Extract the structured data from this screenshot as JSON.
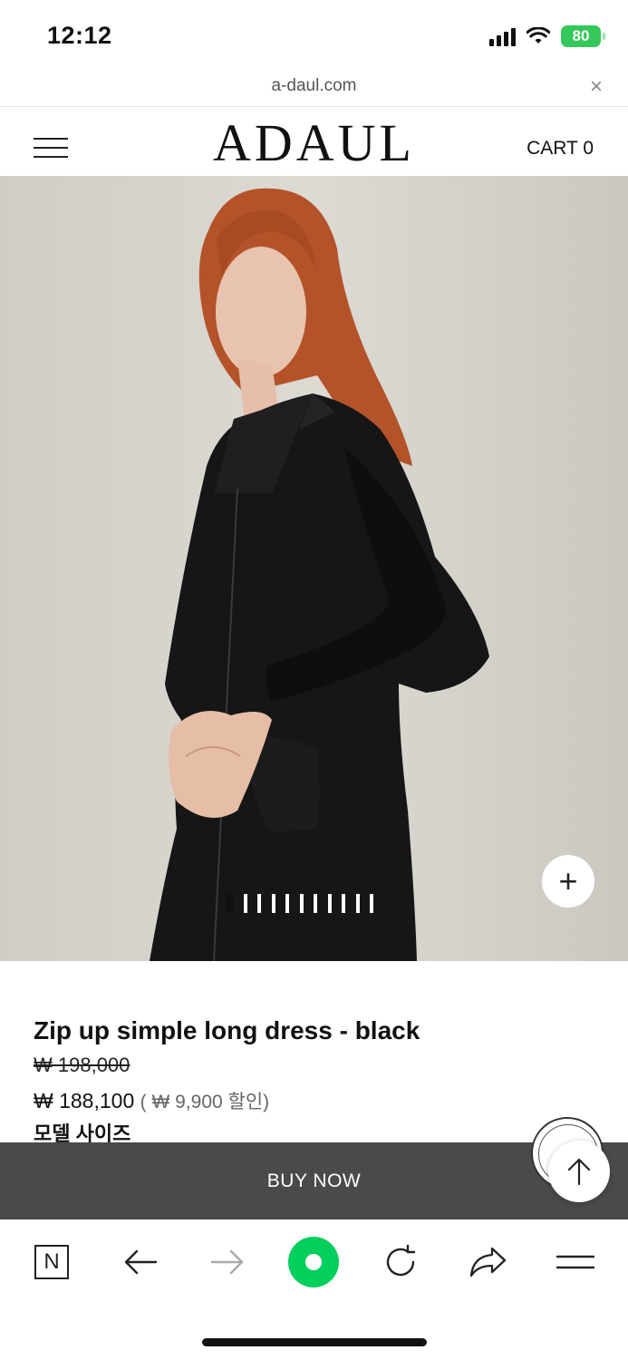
{
  "status_bar": {
    "time": "12:12",
    "battery": "80"
  },
  "url_bar": {
    "url": "a-daul.com",
    "close_icon": "×"
  },
  "header": {
    "logo": "ADAUL",
    "cart_label": "CART 0"
  },
  "hero": {
    "slide_count": 11,
    "active_slide": 1,
    "zoom_icon": "+"
  },
  "product": {
    "title": "Zip up simple long dress - black",
    "original_price": "₩ 198,000",
    "sale_price": "₩ 188,100",
    "discount": "( ₩ 9,900 할인)",
    "model_size_label": "모델 사이즈"
  },
  "buy_bar": {
    "label": "BUY NOW"
  },
  "toolbar": {
    "n_label": "N"
  },
  "colors": {
    "accent_green": "#03cf5d",
    "battery_green": "#34c759",
    "buy_bar": "#4a4a4a",
    "hero_background": "#d6d4cd"
  }
}
